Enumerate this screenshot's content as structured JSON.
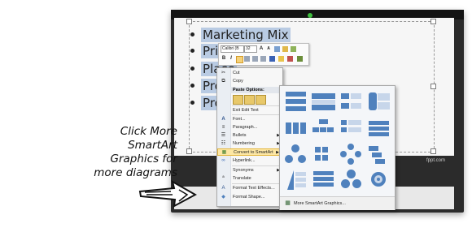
{
  "slide": {
    "bullets": [
      "Marketing Mix",
      "Pric",
      "Place",
      "Pro",
      "Pro"
    ],
    "watermark": "fppt.com"
  },
  "mini_toolbar": {
    "font_value": "Calibri (B",
    "size_value": "32",
    "bold_label": "B",
    "italic_label": "I",
    "grow_font_label": "A",
    "shrink_font_label": "A"
  },
  "context_menu": {
    "items": [
      {
        "label": "Cut",
        "icon": "scissors-icon"
      },
      {
        "label": "Copy",
        "icon": "copy-icon"
      },
      {
        "label": "Paste Options:",
        "icon": ""
      },
      {
        "label": "Exit Edit Text",
        "icon": ""
      },
      {
        "label": "Font...",
        "icon": "font-icon"
      },
      {
        "label": "Paragraph...",
        "icon": "paragraph-icon"
      },
      {
        "label": "Bullets",
        "icon": "bullets-icon"
      },
      {
        "label": "Numbering",
        "icon": "numbering-icon"
      },
      {
        "label": "Convert to SmartArt",
        "icon": "smartart-icon"
      },
      {
        "label": "Hyperlink...",
        "icon": "hyperlink-icon"
      },
      {
        "label": "Synonyms",
        "icon": ""
      },
      {
        "label": "Translate",
        "icon": "translate-icon"
      },
      {
        "label": "Format Text Effects...",
        "icon": "text-effects-icon"
      },
      {
        "label": "Format Shape...",
        "icon": "format-shape-icon"
      }
    ]
  },
  "smartart_gallery": {
    "more_label": "More SmartArt Graphics..."
  },
  "annotation": {
    "lines": [
      "Click More",
      "SmartArt",
      "Graphics for",
      "more diagrams"
    ]
  },
  "colors": {
    "accent_blue": "#4f81bd",
    "highlight": "#fde7a4",
    "selection": "#b9cbe3"
  }
}
